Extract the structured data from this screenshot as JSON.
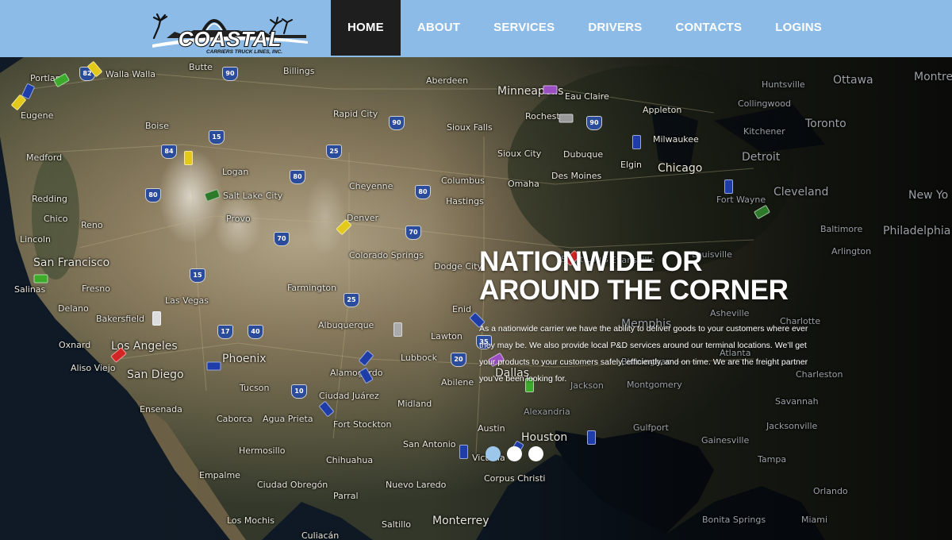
{
  "brand": {
    "name": "COASTAL",
    "tagline": "CARRIERS TRUCK LINES, INC."
  },
  "nav": {
    "items": [
      {
        "label": "HOME",
        "active": true
      },
      {
        "label": "ABOUT"
      },
      {
        "label": "SERVICES"
      },
      {
        "label": "DRIVERS"
      },
      {
        "label": "CONTACTS"
      },
      {
        "label": "LOGINS"
      }
    ]
  },
  "hero": {
    "headline_line1": "NATIONWIDE OR",
    "headline_line2": "AROUND THE CORNER",
    "body": "As a nationwide carrier we have the ability to deliver goods to your customers where ever they may be. We also provide local P&D services around our terminal locations. We’ll get your products to your customers safely, efficiently, and on time. We are the freight partner you’ve been looking for.",
    "slides": {
      "count": 3,
      "active": 1
    }
  },
  "map": {
    "cities": [
      "Portland",
      "Walla Walla",
      "Butte",
      "Billings",
      "Aberdeen",
      "Minneapolis",
      "Eau Claire",
      "Huntsville",
      "Ottawa",
      "Montre",
      "Eugene",
      "Boise",
      "Rapid City",
      "Sioux Falls",
      "Rochester",
      "Appleton",
      "Collingwood",
      "Toronto",
      "Kitchener",
      "Medford",
      "Logan",
      "Sioux City",
      "Dubuque",
      "Milwaukee",
      "Detroit",
      "Redding",
      "Salt Lake City",
      "Cheyenne",
      "Omaha",
      "Des Moines",
      "Chicago",
      "Cleveland",
      "New Yo",
      "Chico",
      "Provo",
      "Columbus",
      "Hastings",
      "Elgin",
      "Fort Wayne",
      "Baltimore",
      "Philadelphia",
      "Reno",
      "Denver",
      "Lincoln",
      "Dodge City",
      "Saint Louis",
      "Evansville",
      "Louisville",
      "Arlington",
      "San Francisco",
      "Colorado Springs",
      "Fresno",
      "Salinas",
      "Farmington",
      "Las Vegas",
      "Bakersfield",
      "Delano",
      "Enid",
      "Memphis",
      "Albuquerque",
      "Asheville",
      "Charlotte",
      "Lawton",
      "Oxnard",
      "Los Angeles",
      "Aliso Viejo",
      "San Diego",
      "Phoenix",
      "Lubbock",
      "Atlanta",
      "Birmingham",
      "Alamogordo",
      "Tucson",
      "Ciudad Juárez",
      "Abilene",
      "Dallas",
      "Jackson",
      "Montgomery",
      "Savannah",
      "Charleston",
      "Ensenada",
      "Caborca",
      "Agua Prieta",
      "Midland",
      "Alexandria",
      "Gulfport",
      "Jacksonville",
      "Fort Stockton",
      "Austin",
      "Houston",
      "Hermosillo",
      "Chihuahua",
      "San Antonio",
      "Victoria",
      "Gainesville",
      "Empalme",
      "Ciudad Obregón",
      "Corpus Christi",
      "Nuevo Laredo",
      "Parral",
      "Los Mochis",
      "Saltillo",
      "Monterrey",
      "Miami",
      "Culiacán",
      "Bonita Springs",
      "Tampa",
      "Orlando"
    ],
    "highways": [
      "82",
      "90",
      "90",
      "90",
      "84",
      "15",
      "25",
      "80",
      "80",
      "80",
      "70",
      "70",
      "15",
      "25",
      "17",
      "40",
      "10",
      "35",
      "20"
    ]
  },
  "colors": {
    "header_bg": "#8bbbe6",
    "nav_active_bg": "#1e1e1e",
    "dot_active": "#9cc6ea",
    "dot": "#ffffff"
  }
}
